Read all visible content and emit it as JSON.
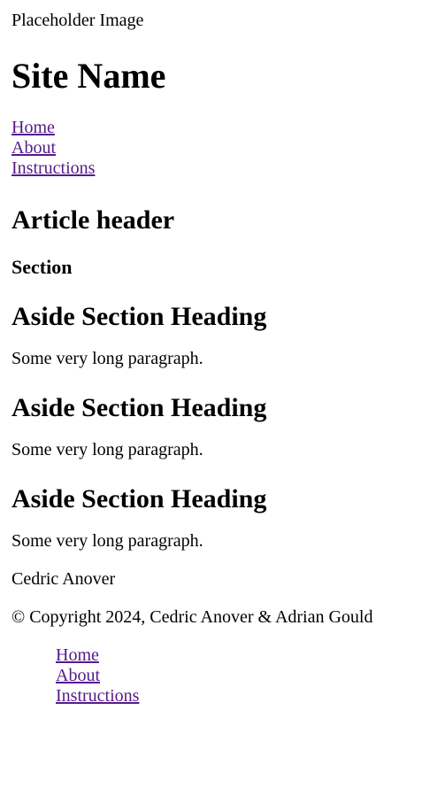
{
  "header": {
    "logo_alt": "Placeholder Image",
    "site_name": "Site Name",
    "nav": [
      {
        "label": "Home"
      },
      {
        "label": "About"
      },
      {
        "label": "Instructions"
      }
    ]
  },
  "main": {
    "article_header": "Article header",
    "section_heading": "Section"
  },
  "aside": {
    "sections": [
      {
        "heading": "Aside Section Heading",
        "paragraph": "Some very long paragraph."
      },
      {
        "heading": "Aside Section Heading",
        "paragraph": "Some very long paragraph."
      },
      {
        "heading": "Aside Section Heading",
        "paragraph": "Some very long paragraph."
      }
    ]
  },
  "footer": {
    "author": "Cedric Anover",
    "copyright": "© Copyright 2024, Cedric Anover & Adrian Gould",
    "nav": [
      {
        "label": "Home"
      },
      {
        "label": "About"
      },
      {
        "label": "Instructions"
      }
    ]
  },
  "colors": {
    "link_visited": "#551a8b",
    "text": "#000000",
    "background": "#ffffff"
  }
}
